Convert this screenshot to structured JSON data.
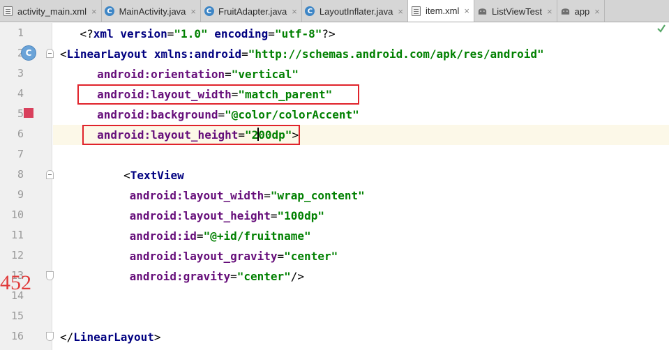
{
  "tabs": [
    {
      "label": "activity_main.xml",
      "icon": "xml-file-icon",
      "active": false
    },
    {
      "label": "MainActivity.java",
      "icon": "class-icon",
      "active": false
    },
    {
      "label": "FruitAdapter.java",
      "icon": "class-icon",
      "active": false
    },
    {
      "label": "LayoutInflater.java",
      "icon": "class-icon",
      "active": false
    },
    {
      "label": "item.xml",
      "icon": "xml-file-icon",
      "active": true
    },
    {
      "label": "ListViewTest",
      "icon": "android-module-icon",
      "active": false
    },
    {
      "label": "app",
      "icon": "android-module-icon",
      "active": false
    }
  ],
  "close_glyph": "×",
  "gutter": {
    "line_numbers": [
      "1",
      "2",
      "3",
      "4",
      "5",
      "6",
      "7",
      "8",
      "9",
      "10",
      "11",
      "12",
      "13",
      "14",
      "15",
      "16"
    ],
    "class_badge": "C",
    "overlay_number": "452"
  },
  "code_lines": [
    "<?xml version=\"1.0\" encoding=\"utf-8\"?>",
    "<LinearLayout xmlns:android=\"http://schemas.android.com/apk/res/android\"",
    "    android:orientation=\"vertical\"",
    "    android:layout_width=\"match_parent\"",
    "    android:background=\"@color/colorAccent\"",
    "    android:layout_height=\"200dp\">",
    "",
    "        <TextView",
    "            android:layout_width=\"wrap_content\"",
    "            android:layout_height=\"100dp\"",
    "            android:id=\"@+id/fruitname\"",
    "            android:layout_gravity=\"center\"",
    "            android:gravity=\"center\"/>",
    "",
    "",
    "</LinearLayout>"
  ],
  "tokens": {
    "l1": {
      "open": "<?",
      "kw": "xml",
      "sp1": " ",
      "a1": "version",
      "eq": "=",
      "v1": "\"1.0\"",
      "sp2": " ",
      "a2": "encoding",
      "v2": "\"utf-8\"",
      "close": "?>"
    },
    "l2": {
      "open": "<",
      "tag": "LinearLayout",
      "sp": " ",
      "ns": "xmlns:android",
      "eq": "=",
      "val": "\"http://schemas.android.com/apk/res/android\""
    },
    "l3": {
      "attr": "android:orientation",
      "eq": "=",
      "val": "\"vertical\""
    },
    "l4": {
      "attr": "android:layout_width",
      "eq": "=",
      "val": "\"match_parent\""
    },
    "l5": {
      "attr": "android:background",
      "eq": "=",
      "val": "\"@color/colorAccent\""
    },
    "l6": {
      "attr": "android:layout_height",
      "eq": "=",
      "val_a": "\"2",
      "val_b": "00dp\"",
      "close": ">"
    },
    "l8": {
      "open": "<",
      "tag": "TextView"
    },
    "l9": {
      "attr": "android:layout_width",
      "eq": "=",
      "val": "\"wrap_content\""
    },
    "l10": {
      "attr": "android:layout_height",
      "eq": "=",
      "val": "\"100dp\""
    },
    "l11": {
      "attr": "android:id",
      "eq": "=",
      "val": "\"@+id/fruitname\""
    },
    "l12": {
      "attr": "android:layout_gravity",
      "eq": "=",
      "val": "\"center\""
    },
    "l13": {
      "attr": "android:gravity",
      "eq": "=",
      "val": "\"center\"",
      "close": "/>"
    },
    "l16": {
      "open": "</",
      "tag": "LinearLayout",
      "close": ">"
    }
  },
  "colors": {
    "tag": "#000080",
    "attribute": "#660e7a",
    "string": "#008000",
    "highlight_box": "#e0232b",
    "current_line": "#fcf8e8"
  }
}
